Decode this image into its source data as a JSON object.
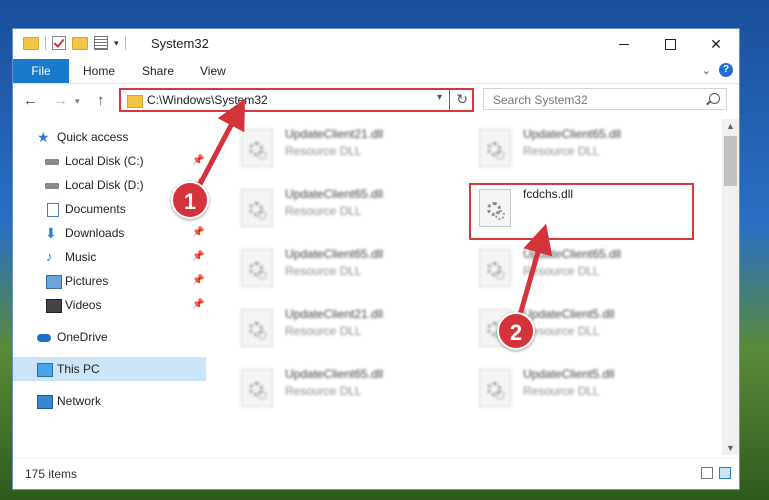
{
  "window": {
    "title": "System32"
  },
  "ribbon": {
    "file": "File",
    "home": "Home",
    "share": "Share",
    "view": "View",
    "help": "?"
  },
  "address": {
    "path": "C:\\Windows\\System32"
  },
  "search": {
    "placeholder": "Search System32"
  },
  "sidebar": {
    "items": [
      {
        "label": "Quick access",
        "icon": "star-icon",
        "pinned": false
      },
      {
        "label": "Local Disk (C:)",
        "icon": "disk-icon",
        "pinned": true
      },
      {
        "label": "Local Disk (D:)",
        "icon": "disk-icon",
        "pinned": true
      },
      {
        "label": "Documents",
        "icon": "document-icon",
        "pinned": true
      },
      {
        "label": "Downloads",
        "icon": "download-icon",
        "pinned": true
      },
      {
        "label": "Music",
        "icon": "music-icon",
        "pinned": true
      },
      {
        "label": "Pictures",
        "icon": "picture-icon",
        "pinned": true
      },
      {
        "label": "Videos",
        "icon": "video-icon",
        "pinned": true
      },
      {
        "label": "OneDrive",
        "icon": "cloud-icon",
        "pinned": false
      },
      {
        "label": "This PC",
        "icon": "computer-icon",
        "pinned": false,
        "selected": true
      },
      {
        "label": "Network",
        "icon": "network-icon",
        "pinned": false
      }
    ]
  },
  "files": [
    {
      "name": "UpdateClient21.dll",
      "type": "Resource DLL"
    },
    {
      "name": "UpdateClient65.dll",
      "type": "Resource DLL"
    },
    {
      "name": "UpdateClient65.dll",
      "type": "Resource DLL"
    },
    {
      "name": "fcdchs.dll",
      "type": "",
      "highlighted": true
    },
    {
      "name": "UpdateClient65.dll",
      "type": "Resource DLL"
    },
    {
      "name": "UpdateClient65.dll",
      "type": "Resource DLL"
    },
    {
      "name": "UpdateClient21.dll",
      "type": "Resource DLL"
    },
    {
      "name": "UpdateClient5.dll",
      "type": "Resource DLL"
    },
    {
      "name": "UpdateClient65.dll",
      "type": "Resource DLL"
    },
    {
      "name": "UpdateClient5.dll",
      "type": "Resource DLL"
    }
  ],
  "status": {
    "item_count": "175 items"
  },
  "callouts": {
    "one": "1",
    "two": "2"
  },
  "colors": {
    "accent": "#1979ca",
    "highlight": "#d9373a",
    "selected": "#cce4f7"
  }
}
